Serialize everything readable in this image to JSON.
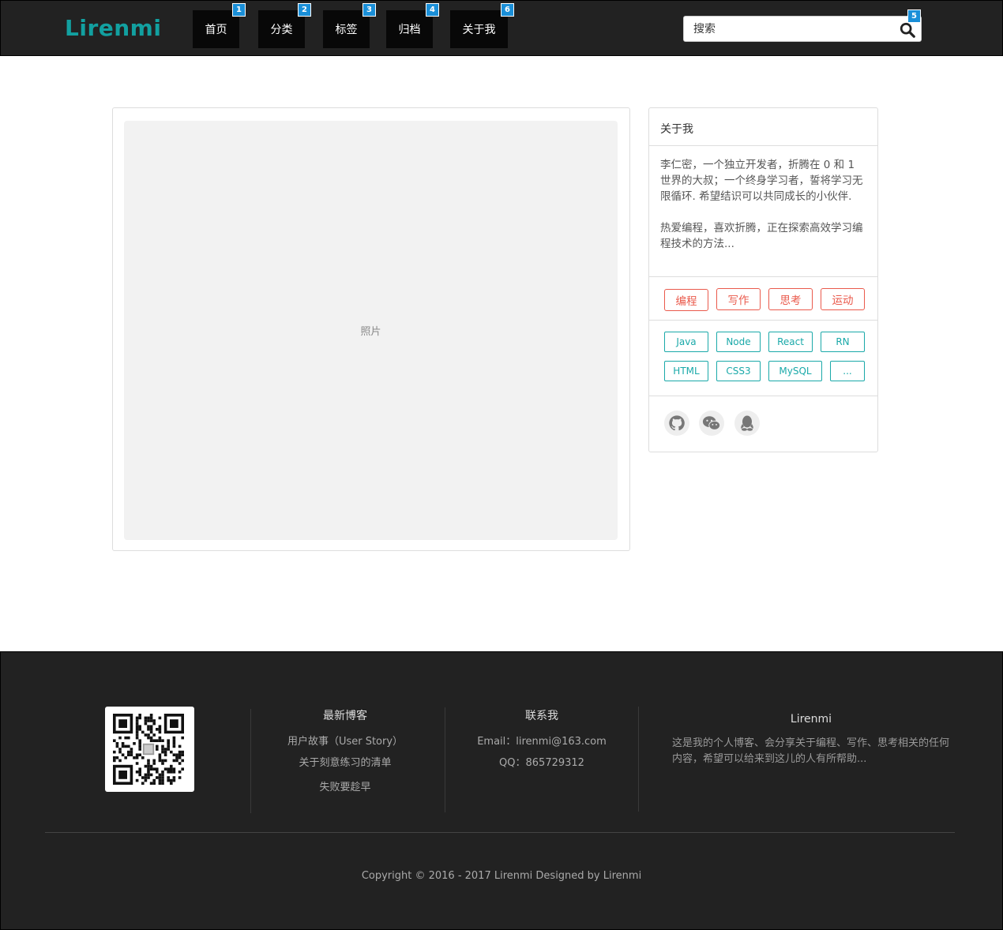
{
  "header": {
    "logo": "Lirenmi",
    "nav": [
      {
        "label": "首页",
        "badge": "1"
      },
      {
        "label": "分类",
        "badge": "2"
      },
      {
        "label": "标签",
        "badge": "3"
      },
      {
        "label": "归档",
        "badge": "4"
      },
      {
        "label": "关于我",
        "badge": "6"
      }
    ],
    "search": {
      "placeholder": "搜索",
      "badge": "5"
    }
  },
  "main": {
    "photo_label": "照片"
  },
  "sidebar": {
    "title": "关于我",
    "desc_p1": "李仁密，一个独立开发者，折腾在 0 和 1 世界的大叔；一个终身学习者，誓将学习无限循环. 希望结识可以共同成长的小伙伴.",
    "desc_p2": "热爱编程，喜欢折腾，正在探索高效学习编程技术的方法...",
    "interests": [
      "编程",
      "写作",
      "思考",
      "运动"
    ],
    "skills": [
      "Java",
      "Node",
      "React",
      "RN",
      "HTML",
      "CSS3",
      "MySQL",
      "..."
    ],
    "social_icons": [
      "github-icon",
      "wechat-icon",
      "qq-icon"
    ]
  },
  "footer": {
    "latest_title": "最新博客",
    "latest_links": [
      "用户故事（User Story）",
      "关于刻意练习的清单",
      "失败要趁早"
    ],
    "contact_title": "联系我",
    "email": "Email：lirenmi@163.com",
    "qq": "QQ：865729312",
    "brand_title": "Lirenmi",
    "brand_desc": "这是我的个人博客、会分享关于编程、写作、思考相关的任何内容，希望可以给来到这儿的人有所帮助...",
    "copyright": "Copyright © 2016 - 2017 Lirenmi Designed by Lirenmi"
  },
  "colors": {
    "accent": "#12a0a0",
    "tag_red": "#ea5a4c",
    "badge": "#1a8fd8"
  }
}
